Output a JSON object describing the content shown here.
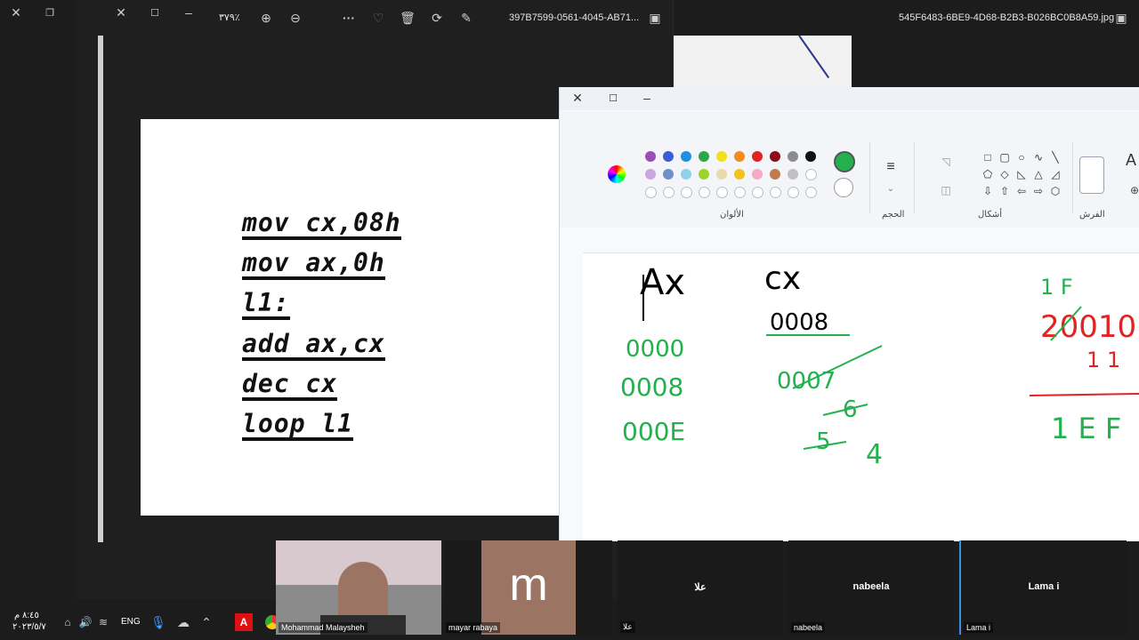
{
  "viewer": {
    "zoom": "٣٧٩٪",
    "filename": "397B7599-0561-4045-AB71..."
  },
  "second_viewer": {
    "filename": "545F6483-6BE9-4D68-B2B3-B026BC0B8A59.jpg"
  },
  "code_lines": [
    "mov cx,08h",
    "mov ax,0h",
    "l1:",
    "add ax,cx",
    "dec cx",
    "loop l1"
  ],
  "paint": {
    "groups": {
      "colors": "الألوان",
      "size": "الحجم",
      "shapes": "أشكال",
      "brushes": "الفرش"
    },
    "text_tool": "A",
    "palette_row1": [
      "#9b4fb5",
      "#3b5fd3",
      "#1e90e0",
      "#2aa84a",
      "#f2e11a",
      "#f28c1c",
      "#e02424",
      "#8b0e1a",
      "#8c8c8c",
      "#111111"
    ],
    "palette_row2": [
      "#c9a7dc",
      "#6f91c6",
      "#8fd0ea",
      "#9ed42a",
      "#ead9a9",
      "#f5c21d",
      "#f6a9c1",
      "#c07a4e",
      "#c0c0c0",
      "#ffffff"
    ],
    "active_color": "#22b14c",
    "handwriting": {
      "ax_label": "Ax",
      "cx_label": "cx",
      "cx_init": "0008",
      "ax_vals": [
        "0000",
        "0008",
        "000E"
      ],
      "cx_vals": [
        "0007",
        "6",
        "5",
        "4"
      ],
      "right_top": "1 F",
      "right_mid": "20010",
      "right_carry": "1 1",
      "right_res": "1 E F"
    }
  },
  "participants": [
    {
      "name": "Mohammad Malaysheh",
      "type": "video"
    },
    {
      "name": "mayar rabaya",
      "initial": "m"
    },
    {
      "name": "علا",
      "label": "علا"
    },
    {
      "name": "nabeela",
      "label": "nabeela"
    },
    {
      "name": "Lama i",
      "label": "Lama i"
    }
  ],
  "taskbar": {
    "time": "٨:٤٥ م",
    "date": "٢٠٢٣/٥/٧",
    "lang": "ENG"
  }
}
